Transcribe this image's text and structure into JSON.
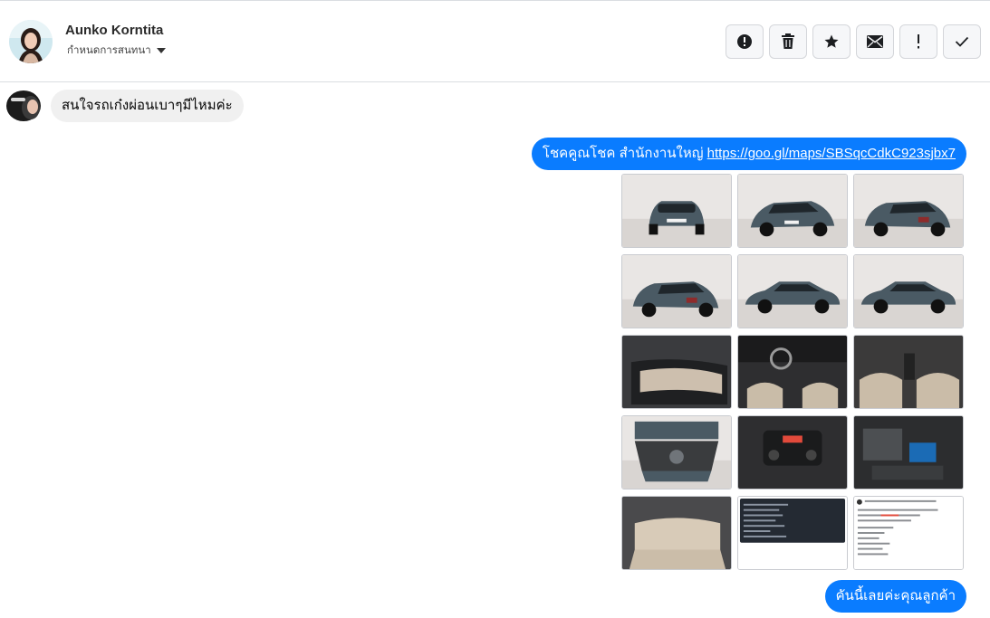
{
  "header": {
    "contact_name": "Aunko Korntita",
    "subtitle": "กำหนดการสนทนา",
    "actions": [
      {
        "name": "report-button",
        "icon": "alert-circle-icon"
      },
      {
        "name": "delete-button",
        "icon": "trash-icon"
      },
      {
        "name": "star-button",
        "icon": "star-icon"
      },
      {
        "name": "mark-unread-button",
        "icon": "envelope-icon"
      },
      {
        "name": "follow-up-button",
        "icon": "exclamation-icon"
      },
      {
        "name": "mark-done-button",
        "icon": "check-icon"
      }
    ]
  },
  "messages": {
    "incoming_1": "สนใจรถเก๋งผ่อนเบาๆมีไหมค่ะ",
    "outgoing_1_text": "โชคคูณโชค สำนักงานใหญ่ ",
    "outgoing_1_link": "https://goo.gl/maps/SBSqcCdkC923sjbx7",
    "outgoing_2": "คันนี้เลยค่ะคุณลูกค้า"
  },
  "photos": [
    {
      "name": "car-front-photo",
      "kind": "car-front"
    },
    {
      "name": "car-front-left-photo",
      "kind": "car-front-angle"
    },
    {
      "name": "car-rear-right-photo",
      "kind": "car-rear-angle"
    },
    {
      "name": "car-rear-left-photo",
      "kind": "car-rear-angle"
    },
    {
      "name": "car-side-left-photo",
      "kind": "car-side"
    },
    {
      "name": "car-side-right-photo",
      "kind": "car-side"
    },
    {
      "name": "door-panel-photo",
      "kind": "interior-door"
    },
    {
      "name": "dashboard-photo",
      "kind": "interior-dash"
    },
    {
      "name": "front-seats-photo",
      "kind": "interior-seats"
    },
    {
      "name": "engine-bay-photo",
      "kind": "engine-open"
    },
    {
      "name": "center-console-photo",
      "kind": "interior-console"
    },
    {
      "name": "engine-closeup-photo",
      "kind": "engine-close"
    },
    {
      "name": "rear-seat-photo",
      "kind": "interior-rear"
    },
    {
      "name": "spec-sheet-dark-photo",
      "kind": "screenshot-dark"
    },
    {
      "name": "spec-sheet-light-photo",
      "kind": "screenshot-light"
    }
  ],
  "colors": {
    "outgoing_bubble": "#0a7cff",
    "incoming_bubble": "#f0f0f0",
    "car_paint": "#4a5a64"
  }
}
